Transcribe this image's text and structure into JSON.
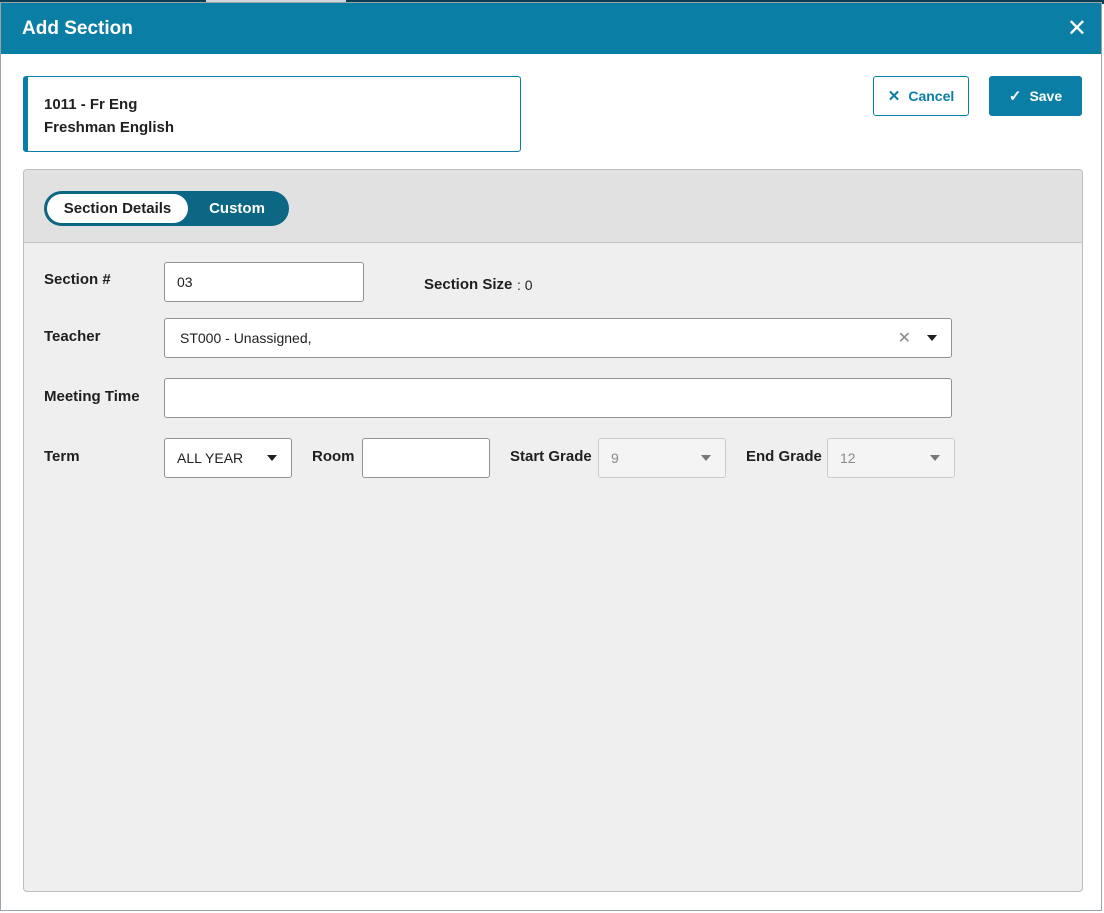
{
  "dialog": {
    "title": "Add Section",
    "close_icon": "close-icon"
  },
  "course": {
    "code_line": "1011 - Fr Eng",
    "name_line": "Freshman English"
  },
  "actions": {
    "cancel_label": "Cancel",
    "cancel_icon": "x-icon",
    "save_label": "Save",
    "save_icon": "check-icon"
  },
  "tabs": {
    "items": [
      {
        "label": "Section Details",
        "active": true
      },
      {
        "label": "Custom",
        "active": false
      }
    ]
  },
  "form": {
    "section_number": {
      "label": "Section #",
      "value": "03"
    },
    "section_size": {
      "label": "Section Size",
      "value": ": 0"
    },
    "teacher": {
      "label": "Teacher",
      "value": "ST000 - Unassigned,"
    },
    "meeting_time": {
      "label": "Meeting Time",
      "value": ""
    },
    "term": {
      "label": "Term",
      "value": "ALL YEAR"
    },
    "room": {
      "label": "Room",
      "value": ""
    },
    "start_grade": {
      "label": "Start Grade",
      "value": "9"
    },
    "end_grade": {
      "label": "End Grade",
      "value": "12"
    }
  },
  "colors": {
    "header": "#0a7ea4",
    "toggle": "#0b6784",
    "panel": "#efefef"
  }
}
